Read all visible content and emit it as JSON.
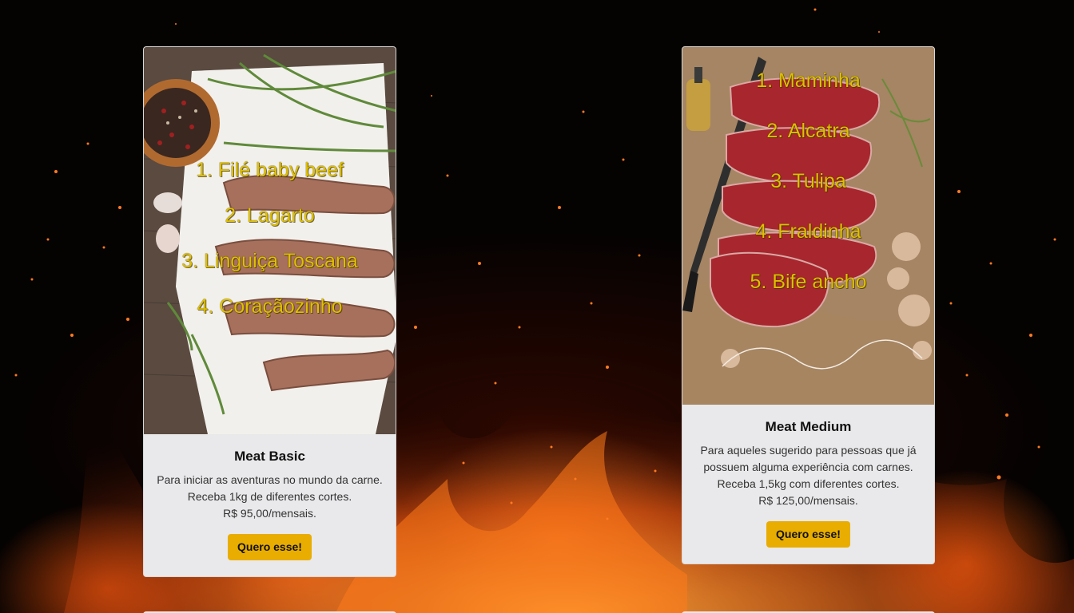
{
  "plans": [
    {
      "image_alt": "Sausages on parchment with rosemary, peppercorns and garlic",
      "image_list": [
        "1. Filé baby beef",
        "2. Lagarto",
        "3. Linguiça Toscana",
        "4. Coraçãozinho"
      ],
      "title": "Meat Basic",
      "description": "Para iniciar as aventuras no mundo da carne. Receba 1kg de diferentes cortes.",
      "price": "R$ 95,00/mensais.",
      "button_label": "Quero esse!"
    },
    {
      "image_alt": "Raw steaks with knife, olive oil and mushrooms on brown paper",
      "image_list": [
        "1. Maminha",
        "2. Alcatra",
        "3. Tulipa",
        "4. Fraldinha",
        "5. Bife ancho"
      ],
      "title": "Meat Medium",
      "description": "Para aqueles sugerido para pessoas que já possuem alguma experiência com carnes. Receba 1,5kg com diferentes cortes.",
      "price": "R$ 125,00/mensais.",
      "button_label": "Quero esse!"
    }
  ],
  "colors": {
    "accent": "#e8ad00",
    "image_text": "#e0c000",
    "card_bg": "#e9e8ea"
  }
}
